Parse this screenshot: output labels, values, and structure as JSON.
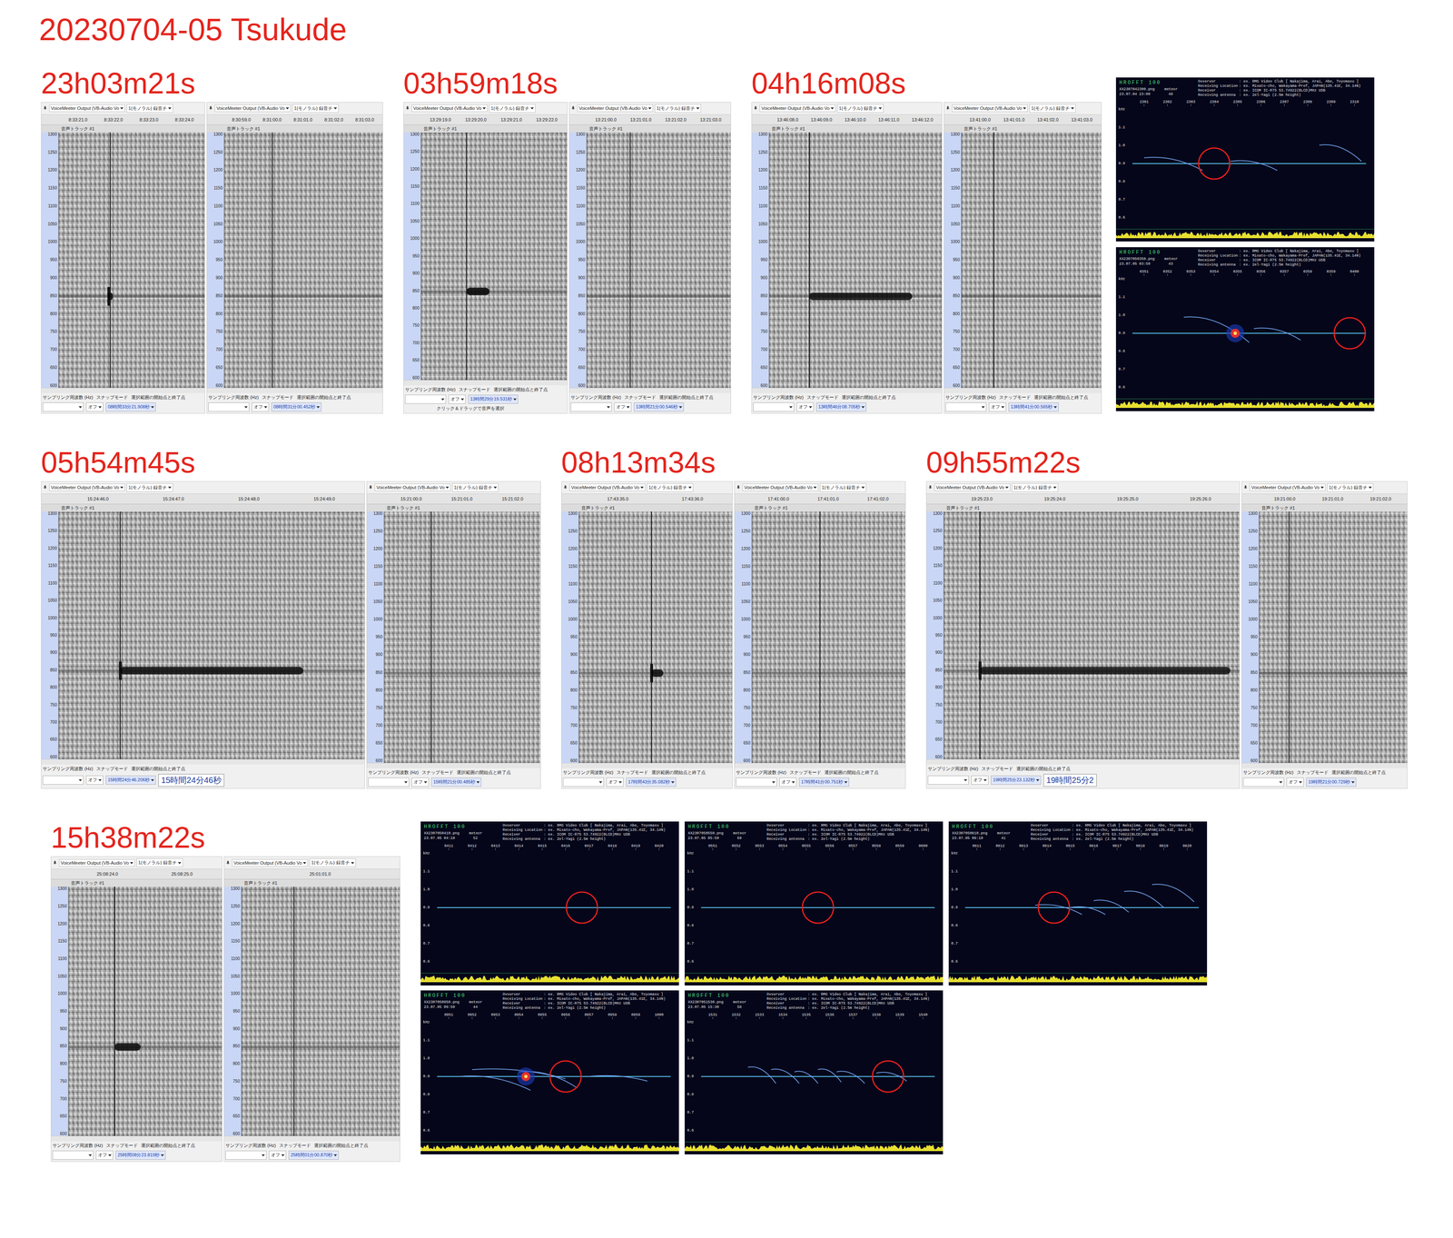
{
  "title": "20230704-05  Tsukude",
  "device": "VoiceMeeter Output (VB-Audio Vo",
  "channel": "1(モノラル) 録音チ",
  "track": "音声トラック #1",
  "freq_axis": [
    "1300",
    "1250",
    "1200",
    "1150",
    "1100",
    "1050",
    "1000",
    "950",
    "900",
    "850",
    "800",
    "750",
    "700",
    "650",
    "600"
  ],
  "footer_labels": [
    "サンプリング周波数 (Hz)",
    "スナップモード",
    "選択範囲の開始点と終了点"
  ],
  "snap": "オフ",
  "hrofft_header": {
    "logo": "HROFFT 100",
    "meteor_label": "meteor",
    "lines": [
      [
        "Ovserver",
        ": ex. RMG Video Club [ Nakajima, Arai, Abe, Toyomasu ]"
      ],
      [
        "Receiving Location",
        ": ex. Misato-cho, Wakayama-Pref, JAPAN(135.41E, 34.14N)"
      ],
      [
        "Receiver",
        ": ex. ICOM IC-R75 53.74922(BLCD)MHz USB"
      ],
      [
        "Receiving antenna",
        ": ex. 2el-Yagi (2.5m height)"
      ]
    ],
    "axis": [
      "kHz",
      "1.1",
      "1.0",
      "0.9",
      "0.8",
      "0.7",
      "0.6"
    ]
  },
  "rows": [
    {
      "events": [
        {
          "time": "23h03m21s",
          "panels": [
            {
              "ticks": [
                "8:33:21.0",
                "8:33:22.0",
                "8:33:23.0",
                "8:33:24.0"
              ],
              "cursor": 0.35,
              "carrier": {
                "hz": 850,
                "level": 0.45
              },
              "echo": {
                "start": 0.34,
                "length": 0.03,
                "level": 0.85,
                "head": true
              },
              "selection": "08時間33分21.908秒"
            },
            {
              "ticks": [
                "8:30:59.0",
                "8:31:00.0",
                "8:31:01.0",
                "8:31:02.0",
                "8:31:03.0"
              ],
              "cursor": 0.3,
              "carrier": {
                "hz": 850,
                "level": 0.45
              },
              "echo": null,
              "selection": "08時間31分00.452秒"
            }
          ]
        },
        {
          "time": "03h59m18s",
          "panels": [
            {
              "ticks": [
                "13:29:19.0",
                "13:29:20.0",
                "13:29:21.0",
                "13:29:22.0"
              ],
              "cursor": 0.31,
              "carrier": {
                "hz": 850,
                "level": 0.4
              },
              "echo": {
                "start": 0.31,
                "length": 0.16,
                "level": 0.9,
                "head": false
              },
              "selection": "13時間29分19.531秒",
              "status": "クリック＆ドラッグで音声を選択"
            },
            {
              "ticks": [
                "13:21:00.0",
                "13:21:01.0",
                "13:21:02.0",
                "13:21:03.0"
              ],
              "cursor": 0.3,
              "carrier": {
                "hz": 850,
                "level": 0.45
              },
              "echo": null,
              "selection": "13時間21分00.546秒"
            }
          ]
        },
        {
          "time": "04h16m08s",
          "panels": [
            {
              "ticks": [
                "13:46:08.0",
                "13:46:09.0",
                "13:46:10.0",
                "13:46:11.0",
                "13:46:12.0"
              ],
              "cursor": 0.23,
              "carrier": {
                "hz": 850,
                "level": 0.4
              },
              "echo": {
                "start": 0.23,
                "length": 0.6,
                "level": 0.85,
                "head": false
              },
              "selection": "13時間46分08.705秒"
            },
            {
              "ticks": [
                "13:41:00.0",
                "13:41:01.0",
                "13:41:02.0",
                "13:41:03.0"
              ],
              "cursor": 0.23,
              "carrier": {
                "hz": 850,
                "level": 0.45
              },
              "echo": null,
              "selection": "13時間41分00.565秒"
            }
          ]
        }
      ],
      "hrofft": [
        {
          "file": "XX2307042300.png",
          "meteor": "48",
          "date": "23.07.04 23:00",
          "ticks": [
            "2301",
            "2302",
            "2303",
            "2304",
            "2305",
            "2306",
            "2307",
            "2308",
            "2309",
            "2310"
          ],
          "circle": 0.35,
          "streaks": [
            [
              0.05,
              0.45,
              0.3,
              0.56
            ],
            [
              0.42,
              0.48,
              0.62,
              0.56
            ],
            [
              0.8,
              0.34,
              0.98,
              0.48
            ]
          ],
          "burst": null
        },
        {
          "file": "XX2307050350.png",
          "meteor": "43",
          "date": "23.07.05 03:50",
          "ticks": [
            "0351",
            "0352",
            "0353",
            "0354",
            "0355",
            "0356",
            "0357",
            "0358",
            "0359",
            "0400"
          ],
          "circle": 0.93,
          "streaks": [
            [
              0.22,
              0.36,
              0.5,
              0.58
            ],
            [
              0.52,
              0.46,
              0.72,
              0.56
            ]
          ],
          "burst": 0.44
        }
      ]
    },
    {
      "events": [
        {
          "time": "05h54m45s",
          "panels": [
            {
              "ticks": [
                "15:24:46.0",
                "15:24:47.0",
                "15:24:48.0",
                "15:24:49.0"
              ],
              "cursor": 0.2,
              "carrier": {
                "hz": 850,
                "level": 0.4
              },
              "echo": {
                "start": 0.2,
                "length": 0.6,
                "level": 0.85,
                "head": true
              },
              "selection": "15時間24分46.206秒",
              "big_reading": "15時間24分46秒"
            },
            {
              "ticks": [
                "15:21:00.0",
                "15:21:01.0",
                "15:21:02.0"
              ],
              "cursor": 0.3,
              "carrier": {
                "hz": 850,
                "level": 0.45
              },
              "echo": null,
              "selection": "15時間21分00.485秒"
            }
          ]
        },
        {
          "time": "08h13m34s",
          "panels": [
            {
              "ticks": [
                "17:43:35.0",
                "17:43:36.0"
              ],
              "cursor": 0.47,
              "carrier": {
                "hz": 850,
                "level": 0.45
              },
              "echo": {
                "start": 0.47,
                "length": 0.08,
                "level": 0.85,
                "head": true
              },
              "selection": "17時間43分35.082秒"
            },
            {
              "ticks": [
                "17:41:00.0",
                "17:41:01.0",
                "17:41:02.0"
              ],
              "cursor": 0.44,
              "carrier": {
                "hz": 850,
                "level": 0.45
              },
              "echo": null,
              "selection": "17時間41分00.751秒"
            }
          ]
        },
        {
          "time": "09h55m22s",
          "panels": [
            {
              "ticks": [
                "19:25:23.0",
                "19:25:24.0",
                "19:25:25.0",
                "19:25:26.0"
              ],
              "cursor": 0.12,
              "carrier": {
                "hz": 850,
                "level": 0.4
              },
              "echo": {
                "start": 0.12,
                "length": 0.85,
                "level": 0.8,
                "head": true
              },
              "selection": "19時間25分23.132秒",
              "big_reading": "19時間25分2"
            },
            {
              "ticks": [
                "19:21:00.0",
                "19:21:01.0",
                "19:21:02.0"
              ],
              "cursor": 0.2,
              "carrier": {
                "hz": 850,
                "level": 0.55
              },
              "echo": null,
              "selection": "19時間21分00.729秒"
            }
          ]
        }
      ],
      "hrofft": []
    },
    {
      "events": [
        {
          "time": "15h38m22s",
          "panels": [
            {
              "ticks": [
                "25:08:24.0",
                "25:08:25.0"
              ],
              "cursor": 0.3,
              "carrier": {
                "hz": 850,
                "level": 0.45
              },
              "echo": {
                "start": 0.3,
                "length": 0.17,
                "level": 0.85,
                "head": false
              },
              "selection": "25時間08分23.819秒"
            },
            {
              "ticks": [
                "25:01:01.0"
              ],
              "cursor": 0.33,
              "carrier": {
                "hz": 850,
                "level": 0.45
              },
              "echo": null,
              "selection": "25時間01分00.870秒"
            }
          ]
        }
      ],
      "hrofft": [
        {
          "file": "XX2307050410.png",
          "meteor": "52",
          "date": "23.07.05 04:10",
          "ticks": [
            "0411",
            "0412",
            "0413",
            "0414",
            "0415",
            "0416",
            "0417",
            "0418",
            "0419",
            "0420"
          ],
          "circle": 0.62,
          "streaks": [],
          "burst": null
        },
        {
          "file": "XX2307050550.png",
          "meteor": "69",
          "date": "23.07.05 05:50",
          "ticks": [
            "0551",
            "0552",
            "0553",
            "0554",
            "0555",
            "0556",
            "0557",
            "0558",
            "0559",
            "0600"
          ],
          "circle": 0.5,
          "streaks": [],
          "burst": null
        },
        {
          "file": "XX2307050810.png",
          "meteor": "41",
          "date": "23.07.05 08:10",
          "ticks": [
            "0811",
            "0812",
            "0813",
            "0814",
            "0815",
            "0816",
            "0817",
            "0818",
            "0819",
            "0820"
          ],
          "circle": 0.38,
          "streaks": [
            [
              0.3,
              0.48,
              0.5,
              0.56
            ],
            [
              0.45,
              0.5,
              0.6,
              0.56
            ],
            [
              0.55,
              0.44,
              0.7,
              0.54
            ],
            [
              0.68,
              0.36,
              0.85,
              0.5
            ],
            [
              0.8,
              0.3,
              0.98,
              0.45
            ]
          ],
          "burst": null
        },
        {
          "file": "XX2307050950.png",
          "meteor": "44",
          "date": "23.07.05 09:50",
          "ticks": [
            "0951",
            "0952",
            "0953",
            "0954",
            "0955",
            "0956",
            "0957",
            "0958",
            "0959",
            "1000"
          ],
          "circle": 0.55,
          "streaks": [
            [
              0.1,
              0.5,
              0.4,
              0.62
            ],
            [
              0.15,
              0.44,
              0.55,
              0.52
            ],
            [
              0.35,
              0.46,
              0.6,
              0.6
            ],
            [
              0.65,
              0.5,
              0.9,
              0.54
            ]
          ],
          "burst": 0.38
        },
        {
          "file": "XX2307051530.png",
          "meteor": "58",
          "date": "23.07.05 15:30",
          "ticks": [
            "1531",
            "1532",
            "1533",
            "1534",
            "1535",
            "1536",
            "1537",
            "1538",
            "1539",
            "1540"
          ],
          "circle": 0.8,
          "streaks": [
            [
              0.2,
              0.42,
              0.32,
              0.56
            ],
            [
              0.3,
              0.44,
              0.42,
              0.56
            ],
            [
              0.4,
              0.46,
              0.5,
              0.56
            ],
            [
              0.5,
              0.44,
              0.6,
              0.55
            ],
            [
              0.58,
              0.46,
              0.7,
              0.56
            ],
            [
              0.75,
              0.47,
              0.88,
              0.54
            ]
          ],
          "burst": null
        }
      ]
    }
  ]
}
